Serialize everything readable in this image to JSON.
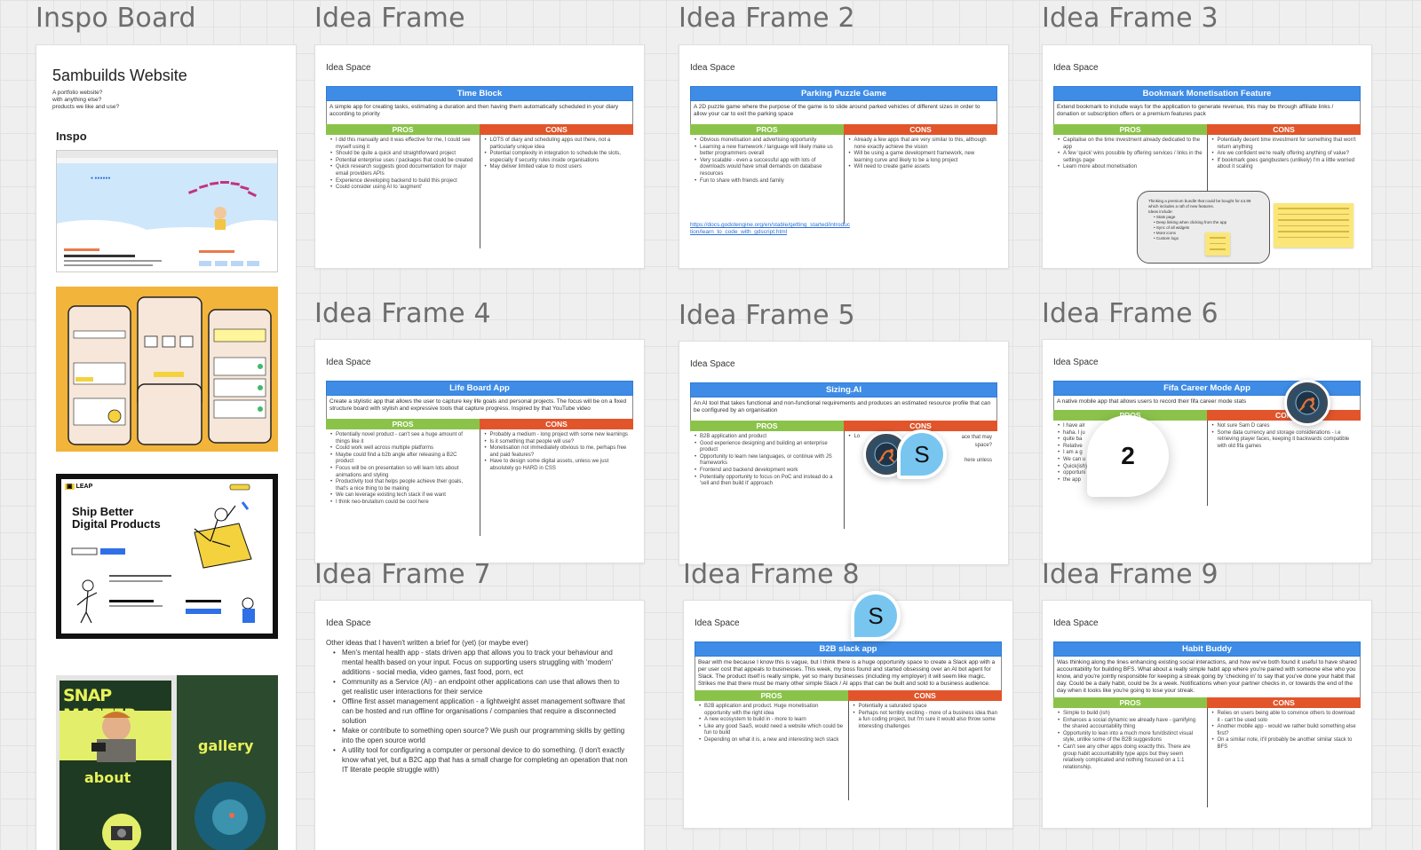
{
  "board": {
    "inspo": {
      "frame_title": "Inspo Board",
      "heading": "5ambuilds Website",
      "sub_lines": [
        "A portfolio website?",
        "with anything else?",
        "products we like and use?"
      ],
      "label": "Inspo",
      "thumb3": {
        "brand": "LEAP",
        "headline_1": "Ship Better",
        "headline_2": "Digital Products"
      },
      "thumb4": {
        "title": "SNAP MASTER",
        "word_1": "about",
        "word_2": "gallery"
      }
    },
    "frames": [
      {
        "title": "Idea Frame",
        "space": "Idea Space",
        "name": "Time Block",
        "desc": "A simple app for creating tasks, estimating a duration and then having them automatically scheduled in your diary according to priority",
        "pros_label": "PROS",
        "cons_label": "CONS",
        "pros": [
          "I did this manually and it was effective for me, I could see myself using it",
          "Should be quite a quick and straightforward project",
          "Potential enterprise uses / packages that could be created",
          "Quick research suggests good documentation for major email providers APIs",
          "Experience developing backend to build this project",
          "Could consider using AI to 'augment'"
        ],
        "cons": [
          "LOTS of diary and scheduling apps out there, not a particularly unique idea",
          "Potential complexity in integration to schedule the slots, especially if security rules inside organisations",
          "May deliver limited value to most users"
        ]
      },
      {
        "title": "Idea Frame 2",
        "space": "Idea Space",
        "name": "Parking Puzzle Game",
        "desc": "A 2D puzzle game where the purpose of the game is to slide around parked vehicles of different sizes in order to allow your car to exit the parking space",
        "pros_label": "PROS",
        "cons_label": "CONS",
        "pros": [
          "Obvious monetisation and advertising opportunity",
          "Learning a new framework / language will likely make us better programmers overall",
          "Very scalable - even a successful app with lots of downloads would have small demands on database resources",
          "Fun to share with friends and family"
        ],
        "cons": [
          "Already a few apps that are very similar to this, although none exactly achieve the vision",
          "Will be using a game development framework, new learning curve and likely to be a long project",
          "Will need to create game assets"
        ],
        "link": "https://docs.godotengine.org/en/stable/getting_started/introduction/learn_to_code_with_gdscript.html"
      },
      {
        "title": "Idea Frame 3",
        "space": "Idea Space",
        "name": "Bookmark Monetisation Feature",
        "desc": "Extend bookmark to include ways for the application to generate revenue, this may be through affiliate links / donation or subscription offers or a premium features pack",
        "pros_label": "PROS",
        "cons_label": "CONS",
        "pros": [
          "Capitalise on the time investment already dedicated to the app",
          "A few 'quick' wins possible by offering services / links in the settings page",
          "Learn more about monetisation"
        ],
        "cons": [
          "Potentially decent time investment for something that won't return anything",
          "Are we confident we're really offering anything of value?",
          "If bookmark goes gangbusters (unlikely) I'm a little worried about it scaling"
        ],
        "note_lines": [
          "Thinking a premium bundle that could be bought for £4.99 which includes a raft of new features.",
          "Ideas include:",
          "Stats page",
          "Deep linking when clicking from the app",
          "Sync of all widgets",
          "More icons",
          "Custom logo"
        ]
      },
      {
        "title": "Idea Frame 4",
        "space": "Idea Space",
        "name": "Life Board App",
        "desc": "Create a stylistic app that allows the user to capture key life goals and personal projects. The focus will be on a fixed structure board with stylish and expressive tools that capture progress. Inspired by that YouTube video",
        "pros_label": "PROS",
        "cons_label": "CONS",
        "pros": [
          "Potentially novel product - can't see a huge amount of things like it",
          "Could work well across multiple platforms",
          "Maybe could find a b2b angle after releasing a B2C product",
          "Focus will be on presentation so will learn lots about animations and styling",
          "Productivity tool that helps people achieve their goals, that's a nice thing to be making",
          "We can leverage existing tech stack if we want",
          "I think neo-brutalism could be cool here"
        ],
        "cons": [
          "Probably a medium - long project with some new learnings",
          "Is it something that people will use?",
          "Monetisation not immediately obvious to me, perhaps free and paid features?",
          "Have to design some digital assets, unless we just absolutely go HARD in CSS"
        ]
      },
      {
        "title": "Idea Frame 5",
        "space": "Idea Space",
        "name": "Sizing.AI",
        "desc": "An AI tool that takes functional and non-functional requirements and produces an estimated resource profile that can be configured by an organisation",
        "pros_label": "PROS",
        "cons_label": "CONS",
        "pros": [
          "B2B application and product",
          "Good experience designing and building an enterprise product",
          "Opportunity to learn new languages, or continue with JS frameworks",
          "Frontend and backend development work",
          "Potentially opportunity to focus on PoC and instead do a 'sell and then build it' approach"
        ],
        "cons": [
          "Lo",
          "ace that may",
          "space?",
          "here unless"
        ]
      },
      {
        "title": "Idea Frame 6",
        "space": "Idea Space",
        "name": "Fifa Career Mode App",
        "desc": "A native mobile app that allows users to record their fifa career mode stats",
        "pros_label": "PROS",
        "cons_label": "CON",
        "pros": [
          "I have alr",
          "haha. I ju",
          "quite ba",
          "Relative",
          "I am a g",
          "We can u",
          "Quick(ish)",
          "opportuni",
          "the app"
        ],
        "cons": [
          "Not sure Sam D cares",
          "Some data currency and storage considerations - i.e retrieving player faces, keeping it backwards compatible with old fifa games"
        ]
      },
      {
        "title": "Idea Frame 7",
        "space": "Idea Space",
        "intro": "Other ideas that I haven't written a brief for (yet) (or maybe ever)",
        "items": [
          "Men's mental health app - stats driven app that allows you to track your behaviour and mental health based on your input. Focus on supporting users struggling with 'modern' additions - social media, video games, fast food, porn, ect",
          "Community as a Service (AI) - an endpoint other applications can use that allows then to get realistic user interactions for their service",
          "Offline first asset management application - a lightweight asset management software that can be hosted and run offline for organisations / companies that require a disconnected solution",
          "Make or contribute to something open source? We push our programming skills by getting into the open source world",
          "A utility tool for configuring a computer or personal device to do something. (I don't exactly know what yet, but a B2C app that has a small charge for completing an operation that non IT literate people struggle with)"
        ]
      },
      {
        "title": "Idea Frame 8",
        "space": "Idea Space",
        "name": "B2B slack app",
        "desc": "Bear with me because I know this is vague, but I think there is a huge opportunity space to create a Slack app with a per user cost that appeals to businesses. This week, my boss found and started obsessing over an AI bot agent for Slack. The product itself is really simple, yet so many businesses (including my employer) it will seem like magic. Strikes me that there must be many other simple Slack / AI apps that can be built and sold to a business audience.",
        "pros_label": "PROS",
        "cons_label": "CONS",
        "pros": [
          "B2B application and product. Huge monetisation opportunity with the right idea",
          "A new ecosystem to build in - more to learn",
          "Like any good SaaS, would need a website which could be fun to build",
          "Depending on what it is, a new and interesting tech stack"
        ],
        "cons": [
          "Potentially a saturated space",
          "Perhaps not terribly exciting - more of a business idea than a fun coding project, but I'm sure it would also throw some interesting challenges"
        ]
      },
      {
        "title": "Idea Frame 9",
        "space": "Idea Space",
        "name": "Habit Buddy",
        "desc": "Was thinking along the lines enhancing existing social interactions, and how we've both found it useful to have shared accountability for building BFS. What about a really simple habit app where you're paired with someone else who you know, and you're jointly responsible for keeping a streak going by 'checking in' to say that you've done your habit that day. Could be a daily habit, could be 3x a week. Notifications when your partner checks in, or towards the end of the day when it looks like you're going to lose your streak.",
        "pros_label": "PROS",
        "cons_label": "CONS",
        "pros": [
          "Simple to build (ish)",
          "Enhances a social dynamic we already have - gamifying the shared accountability thing",
          "Opportunity to lean into a much more fun/distinct visual style, unlike some of the B2B suggestions",
          "Can't see any other apps doing exactly this. There are group habit accountability type apps but they seem relatively complicated and nothing focused on a 1:1 relationship."
        ],
        "cons": [
          "Relies on users being able to convince others to download it - can't be used solo",
          "Another mobile app - would we rather build something else first?",
          "On a similar note, it'll probably be another similar stack to BFS"
        ]
      }
    ],
    "collaborators": {
      "s_initial": "S",
      "comment_count": "2",
      "avatar_icon": "scorpion-avatar-icon"
    },
    "colors": {
      "title_bar": "#3e8ce6",
      "pros": "#8bc34a",
      "cons": "#e2552b",
      "s_bubble": "#78c6f0"
    }
  }
}
